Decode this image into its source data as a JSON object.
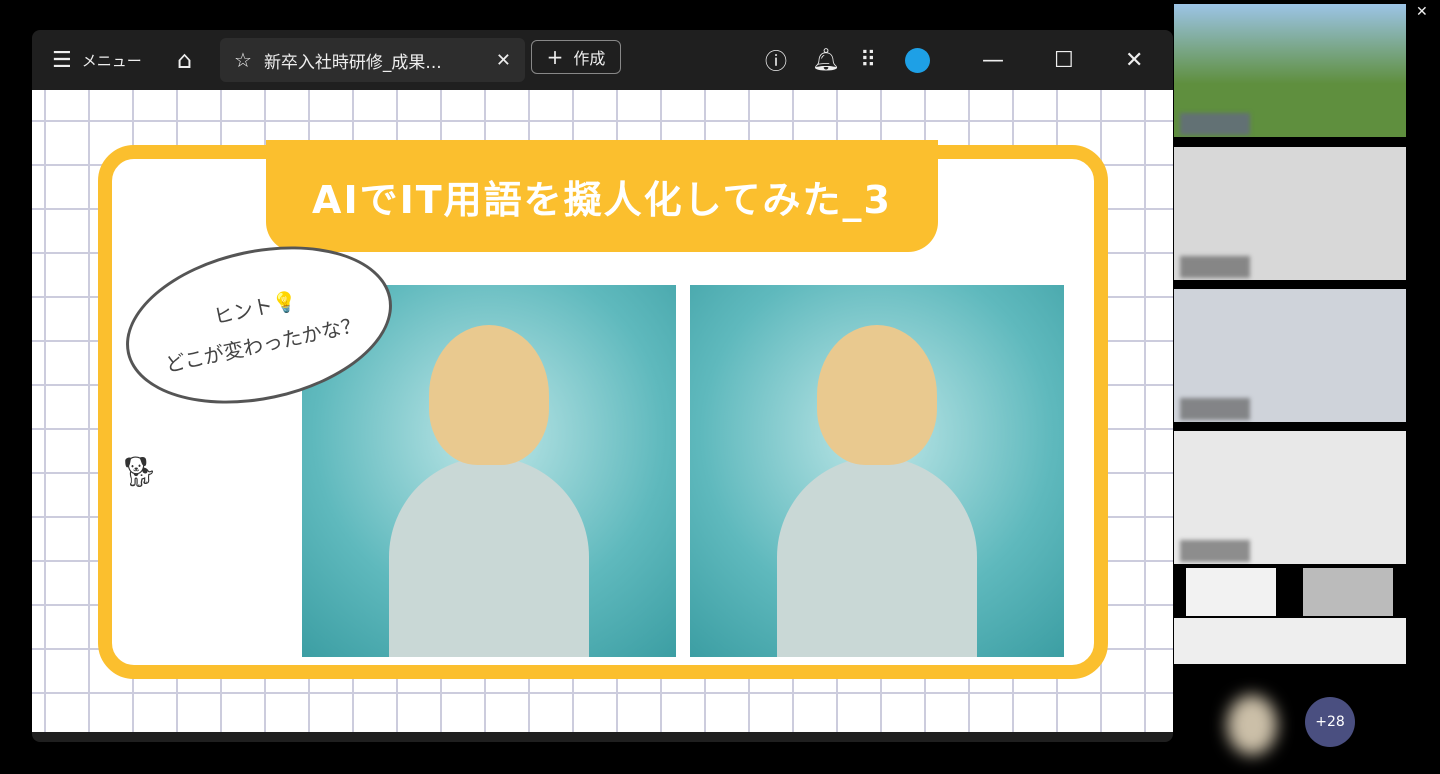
{
  "toolbar": {
    "menu_label": "メニュー",
    "tab_title": "新卒入社時研修_成果...",
    "create_label": "作成"
  },
  "slide": {
    "title": "AIでIT用語を擬人化してみた_3",
    "bubble_line1": "ヒント💡",
    "bubble_line2": "どこが変わったかな？"
  },
  "meeting": {
    "overflow_count": "+28"
  }
}
